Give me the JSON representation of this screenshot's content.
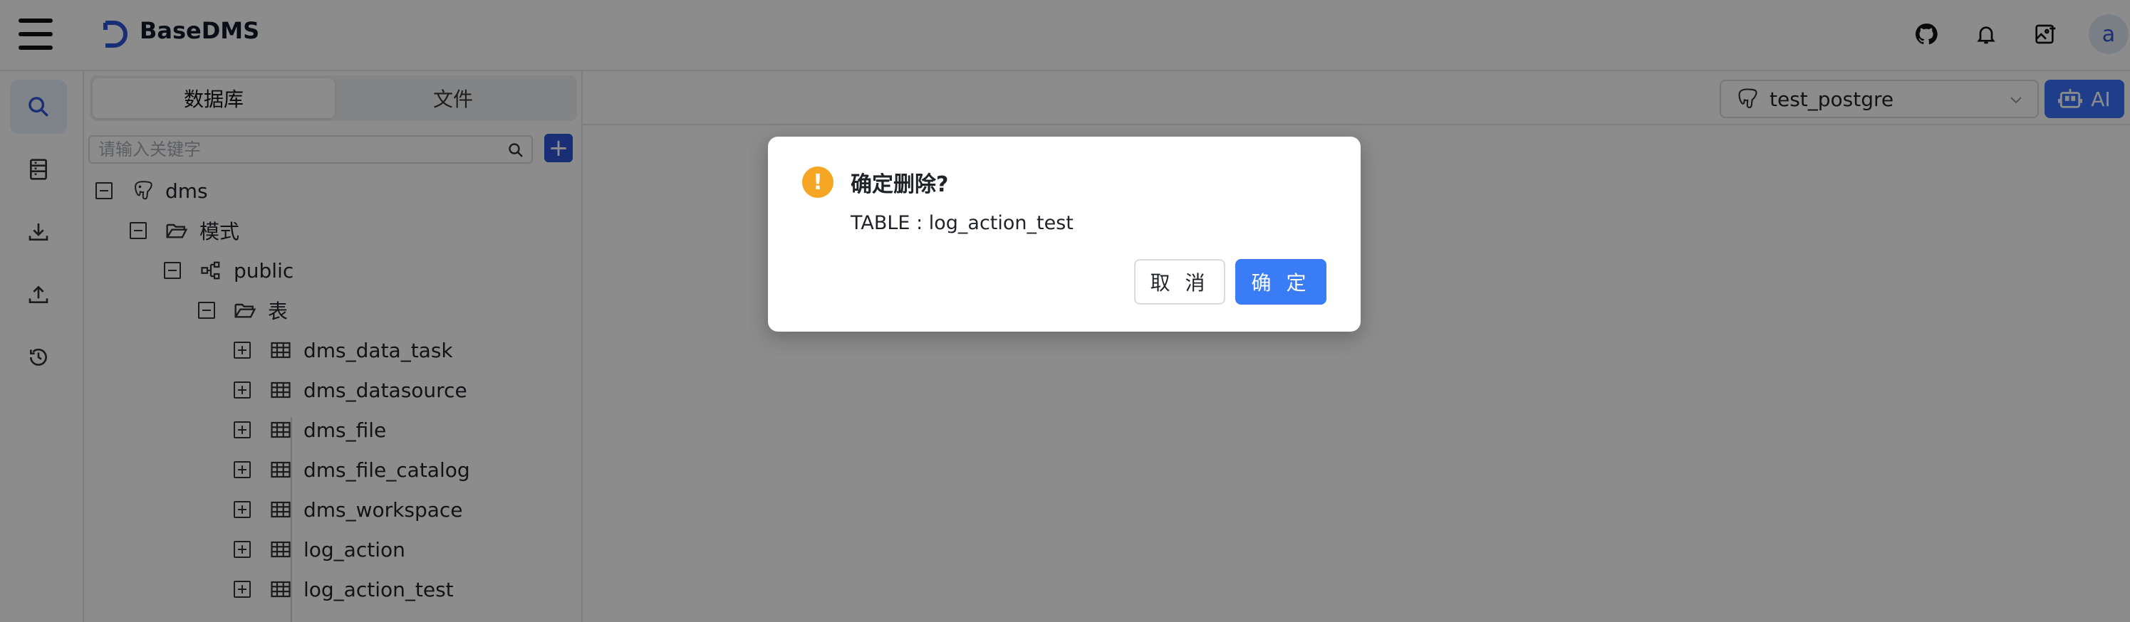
{
  "header": {
    "brand_name": "BaseDMS",
    "avatar_letter": "a",
    "icons": [
      "menu-icon",
      "github-icon",
      "bell-icon",
      "add-image-icon"
    ]
  },
  "rail": {
    "items": [
      {
        "icon": "search-icon",
        "active": true
      },
      {
        "icon": "list-icon",
        "active": false
      },
      {
        "icon": "download-icon",
        "active": false
      },
      {
        "icon": "upload-icon",
        "active": false
      },
      {
        "icon": "history-icon",
        "active": false
      }
    ]
  },
  "sidebar": {
    "tabs": [
      {
        "label": "数据库",
        "active": true
      },
      {
        "label": "文件",
        "active": false
      }
    ],
    "search_placeholder": "请输入关键字",
    "add_label": "+",
    "tree": [
      {
        "label": "dms",
        "icon": "postgres-icon",
        "expanded": true,
        "level": 0
      },
      {
        "label": "模式",
        "icon": "folder-open-icon",
        "expanded": true,
        "level": 1
      },
      {
        "label": "public",
        "icon": "schema-icon",
        "expanded": true,
        "level": 2
      },
      {
        "label": "表",
        "icon": "folder-open-icon",
        "expanded": true,
        "level": 3
      },
      {
        "label": "dms_data_task",
        "icon": "table-icon",
        "expanded": false,
        "level": 4
      },
      {
        "label": "dms_datasource",
        "icon": "table-icon",
        "expanded": false,
        "level": 4
      },
      {
        "label": "dms_file",
        "icon": "table-icon",
        "expanded": false,
        "level": 4
      },
      {
        "label": "dms_file_catalog",
        "icon": "table-icon",
        "expanded": false,
        "level": 4
      },
      {
        "label": "dms_workspace",
        "icon": "table-icon",
        "expanded": false,
        "level": 4
      },
      {
        "label": "log_action",
        "icon": "table-icon",
        "expanded": false,
        "level": 4
      },
      {
        "label": "log_action_test",
        "icon": "table-icon",
        "expanded": false,
        "level": 4
      }
    ]
  },
  "main": {
    "datasource": "test_postgre",
    "ai_label": "AI"
  },
  "modal": {
    "title": "确定删除?",
    "content": "TABLE : log_action_test",
    "cancel_label": "取 消",
    "ok_label": "确 定"
  },
  "colors": {
    "primary": "#3a7bf6",
    "brand": "#2f55d4",
    "warning": "#f5a623"
  }
}
